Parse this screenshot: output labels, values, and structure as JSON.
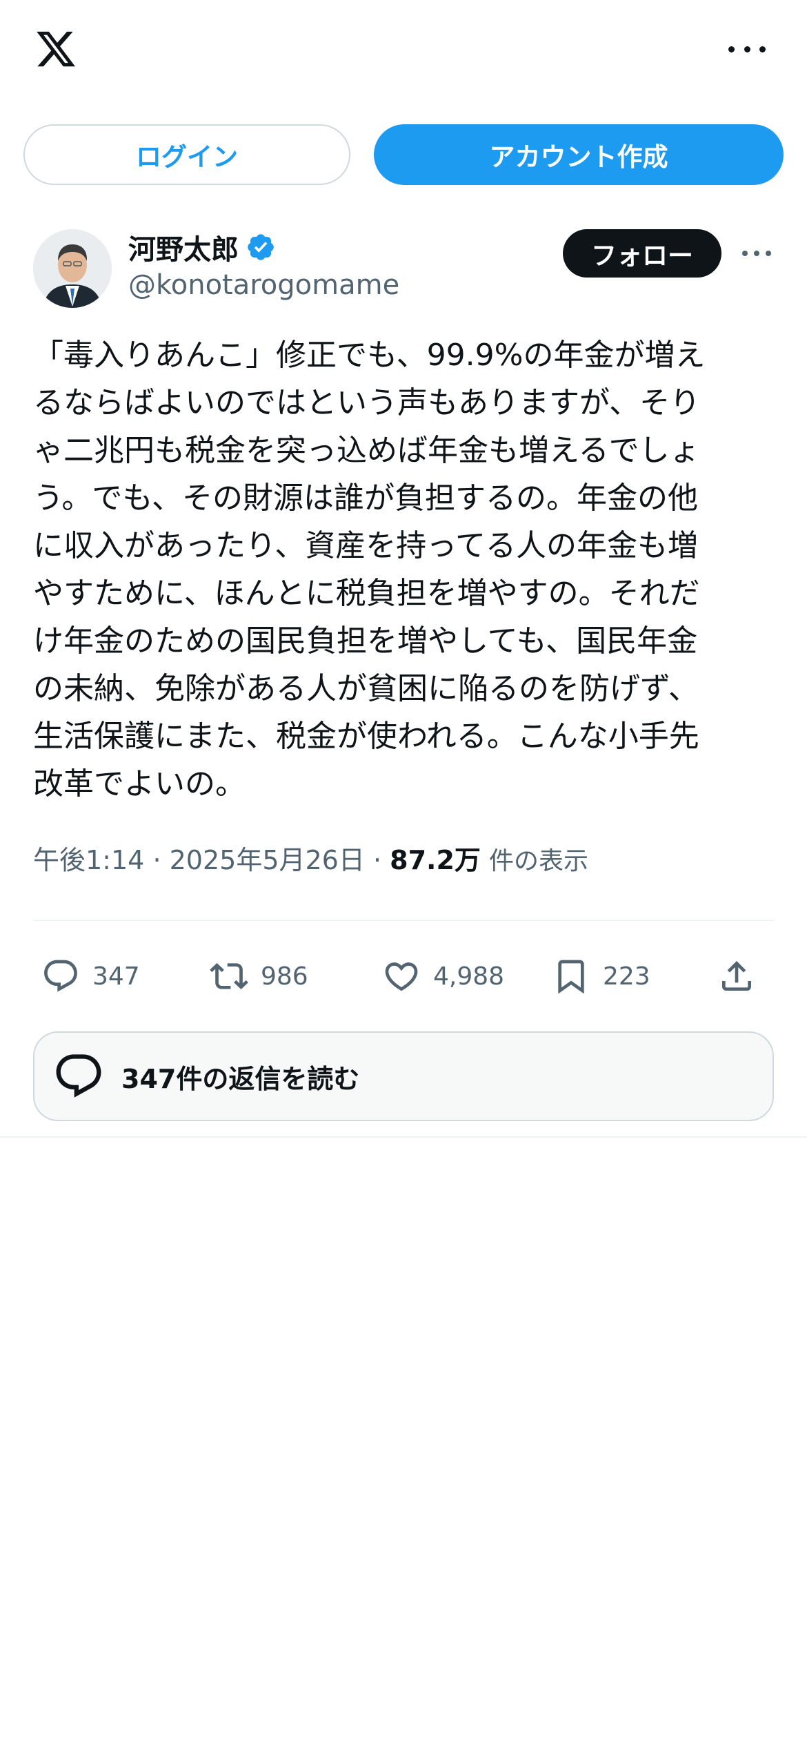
{
  "header": {
    "logo_icon": "x-logo-icon",
    "more_icon": "more-horizontal-icon"
  },
  "auth": {
    "login_label": "ログイン",
    "signup_label": "アカウント作成"
  },
  "tweet": {
    "author": {
      "name": "河野太郎",
      "handle": "@konotarogomame",
      "verified": true,
      "verified_color": "#1d9bf0"
    },
    "follow_label": "フォロー",
    "text": "「毒入りあんこ」修正でも、99.9%の年金が増え\nるならばよいのではという声もありますが、そり\nゃ二兆円も税金を突っ込めば年金も増えるでしょ\nう。でも、その財源は誰が負担するの。年金の他\nに収入があったり、資産を持ってる人の年金も増\nやすために、ほんとに税負担を増やすの。それだ\nけ年金のための国民負担を増やしても、国民年金\nの未納、免除がある人が貧困に陥るのを防げず、\n生活保護にまた、税金が使われる。こんな小手先\n改革でよいの。",
    "time": "午後1:14",
    "date": "2025年5月26日",
    "views_count": "87.2万",
    "views_label": "件の表示",
    "actions": {
      "reply_count": "347",
      "repost_count": "986",
      "like_count": "4,988",
      "bookmark_count": "223"
    },
    "read_replies_label": "347件の返信を読む"
  },
  "colors": {
    "accent": "#1d9bf0",
    "text_primary": "#0f1419",
    "text_secondary": "#536471",
    "border": "#cfd9de"
  }
}
